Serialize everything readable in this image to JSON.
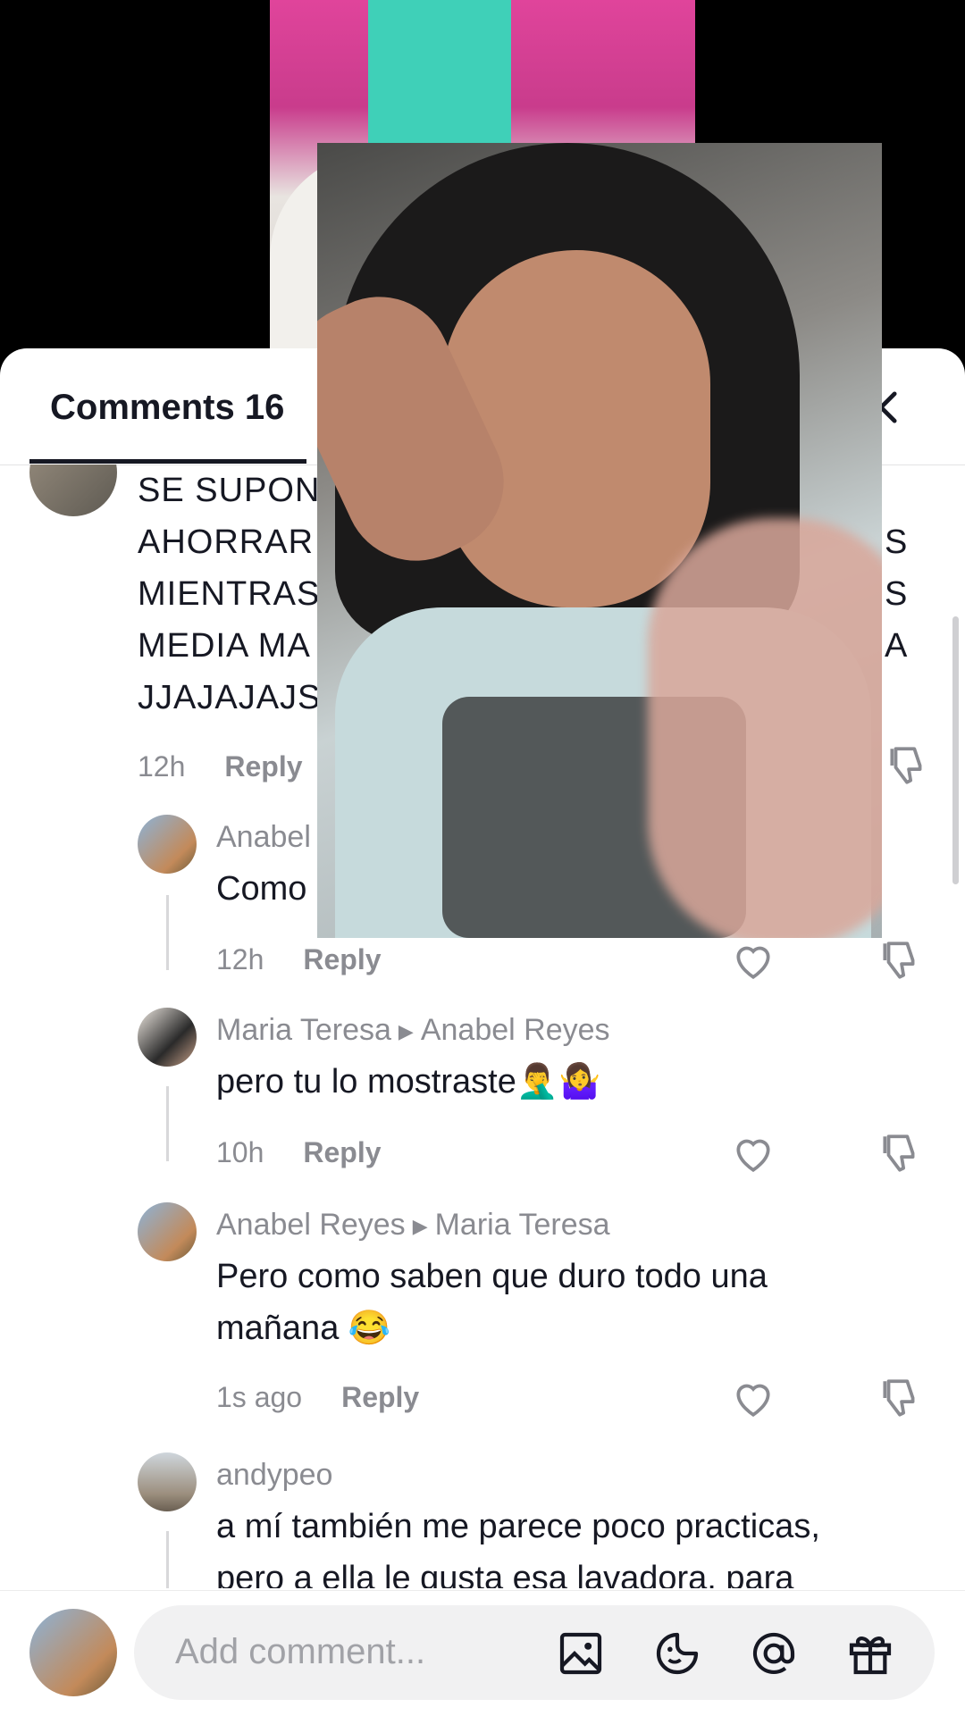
{
  "header": {
    "comments_label": "Comments",
    "comments_count": "16"
  },
  "comments": [
    {
      "id": "c1",
      "lines": [
        "SE SUPONI",
        "AHORRAR",
        "MIENTRAS",
        "MEDIA MA",
        "JJAJAJAJS"
      ],
      "right_fragments": [
        "S",
        "S",
        "A"
      ],
      "time": "12h",
      "reply": "Reply"
    },
    {
      "id": "c2",
      "user": "Anabel",
      "text": "Como",
      "time": "12h",
      "reply": "Reply"
    },
    {
      "id": "c3",
      "user": "Maria Teresa",
      "reply_to": "Anabel Reyes",
      "text": "pero tu lo mostraste🤦‍♂️🤷‍♀️",
      "time": "10h",
      "reply": "Reply"
    },
    {
      "id": "c4",
      "user": "Anabel Reyes",
      "reply_to": "Maria Teresa",
      "text_line1": "Pero como saben que duro todo una",
      "text_line2": "mañana 😂",
      "time": "1s ago",
      "reply": "Reply"
    },
    {
      "id": "c5",
      "user": "andypeo",
      "text_line1": "a mí también me parece poco practicas,",
      "text_line2": "pero a ella le gusta esa lavadora, para"
    }
  ],
  "input": {
    "placeholder": "Add comment..."
  },
  "icons": {
    "filter": "sliders-icon",
    "close": "close-icon",
    "heart": "heart-icon",
    "dislike": "thumbs-down-icon",
    "image": "image-icon",
    "sticker": "sticker-icon",
    "mention": "at-icon",
    "gift": "gift-icon"
  },
  "colors": {
    "text": "#161823",
    "muted": "#8a8b91",
    "background": "#ffffff"
  }
}
